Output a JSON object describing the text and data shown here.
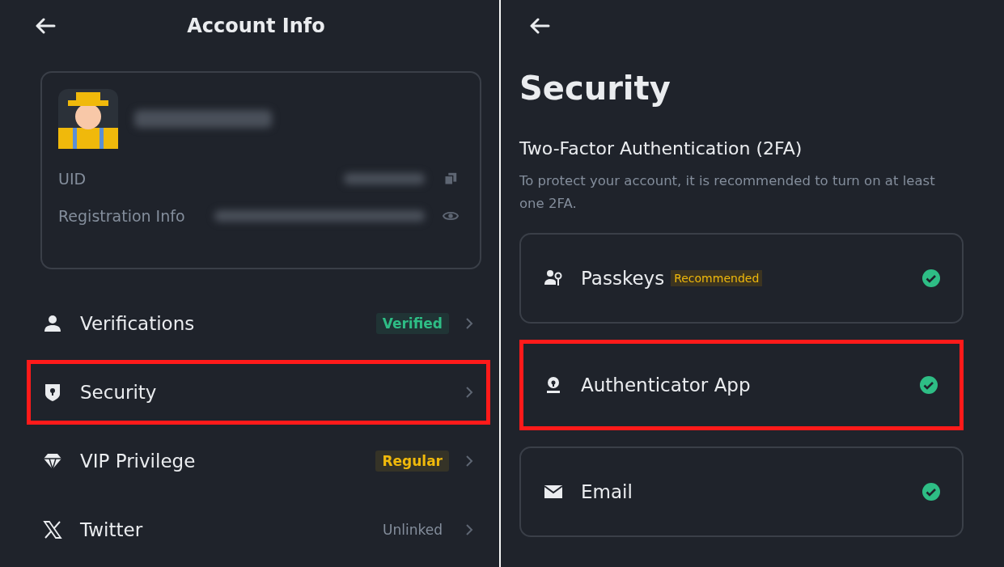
{
  "account": {
    "title": "Account Info",
    "profile": {
      "fields": [
        {
          "label": "UID",
          "kind": "copy"
        },
        {
          "label": "Registration Info",
          "kind": "eye"
        }
      ]
    },
    "menu": [
      {
        "label": "Verifications",
        "kind": "person",
        "status": {
          "text": "Verified",
          "kind": "badge",
          "color": "#2ebd85"
        },
        "highlighted": false
      },
      {
        "label": "Security",
        "kind": "shield",
        "highlighted": true
      },
      {
        "label": "VIP Privilege",
        "kind": "diamond",
        "status": {
          "text": "Regular",
          "kind": "badge",
          "color": "#f0b90b"
        },
        "highlighted": false
      },
      {
        "label": "Twitter",
        "kind": "x",
        "status": {
          "text": "Unlinked",
          "kind": "text"
        },
        "highlighted": false
      }
    ]
  },
  "security": {
    "title": "Security",
    "section": {
      "title": "Two-Factor Authentication (2FA)",
      "description": "To protect your account, it is recommended to turn on at least one 2FA."
    },
    "methods": [
      {
        "label": "Passkeys",
        "kind": "passkey",
        "badge": "Recommended",
        "enabled": true,
        "highlighted": false
      },
      {
        "label": "Authenticator App",
        "kind": "authenticator",
        "enabled": true,
        "highlighted": true
      },
      {
        "label": "Email",
        "kind": "email",
        "enabled": true,
        "highlighted": false
      }
    ]
  }
}
